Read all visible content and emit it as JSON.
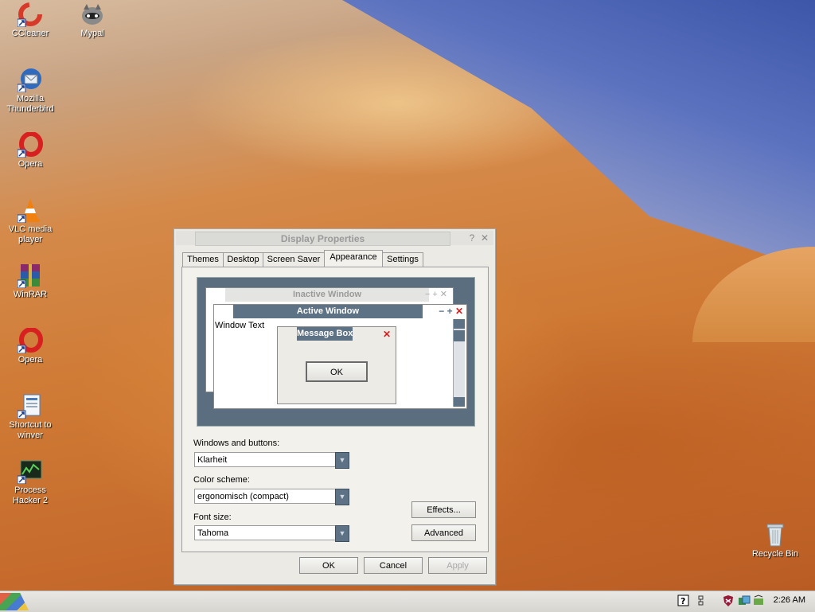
{
  "desktop": {
    "icons": [
      {
        "label": "CCleaner",
        "glyph": "C",
        "color": "#d83a2a"
      },
      {
        "label": "Mypal",
        "glyph": "🦝",
        "color": "#555"
      },
      {
        "label": "Mozilla Thunderbird",
        "glyph": "✉",
        "color": "#2e6bbf"
      },
      {
        "label": "Opera",
        "glyph": "O",
        "color": "#d82020"
      },
      {
        "label": "VLC media player",
        "glyph": "▲",
        "color": "#f08010"
      },
      {
        "label": "WinRAR",
        "glyph": "▦",
        "color": "#8a2a6a"
      },
      {
        "label": "Opera",
        "glyph": "O",
        "color": "#d82020"
      },
      {
        "label": "Shortcut to winver",
        "glyph": "▤",
        "color": "#4a7ab8"
      },
      {
        "label": "Process Hacker 2",
        "glyph": "▣",
        "color": "#3a7a3a"
      },
      {
        "label": "Recycle Bin",
        "glyph": "🗑",
        "color": "#8a9aa8"
      }
    ]
  },
  "window": {
    "title": "Display Properties",
    "help_glyph": "?",
    "close_glyph": "✕",
    "tabs": [
      "Themes",
      "Desktop",
      "Screen Saver",
      "Appearance",
      "Settings"
    ],
    "active_tab": "Appearance",
    "preview": {
      "inactive_title": "Inactive Window",
      "active_title": "Active Window",
      "window_text": "Window Text",
      "message_box_title": "Message Box",
      "ok_label": "OK"
    },
    "windows_buttons_label": "Windows and buttons:",
    "windows_buttons_value": "Klarheit",
    "color_scheme_label": "Color scheme:",
    "color_scheme_value": "ergonomisch (compact)",
    "font_size_label": "Font size:",
    "font_size_value": "Tahoma",
    "effects_label": "Effects...",
    "advanced_label": "Advanced",
    "ok_label": "OK",
    "cancel_label": "Cancel",
    "apply_label": "Apply"
  },
  "taskbar": {
    "clock": "2:26 AM"
  }
}
